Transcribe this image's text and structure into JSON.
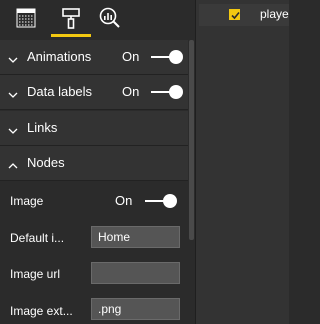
{
  "tabs": [
    {
      "name": "fields-icon"
    },
    {
      "name": "format-paint-icon"
    },
    {
      "name": "analytics-icon"
    }
  ],
  "format": {
    "animations": {
      "label": "Animations",
      "state": "On"
    },
    "data_labels": {
      "label": "Data labels",
      "state": "On"
    },
    "links": {
      "label": "Links"
    },
    "nodes": {
      "label": "Nodes"
    },
    "image": {
      "label": "Image",
      "state": "On"
    },
    "default_image": {
      "label": "Default i...",
      "value": "Home"
    },
    "image_url": {
      "label": "Image url",
      "value": ""
    },
    "image_ext": {
      "label": "Image ext...",
      "value": ".png"
    }
  },
  "fields": {
    "item_label": "playe"
  },
  "colors": {
    "accent": "#f2c811",
    "panel_bg": "#2b2b2b",
    "section_bg": "#333333"
  }
}
